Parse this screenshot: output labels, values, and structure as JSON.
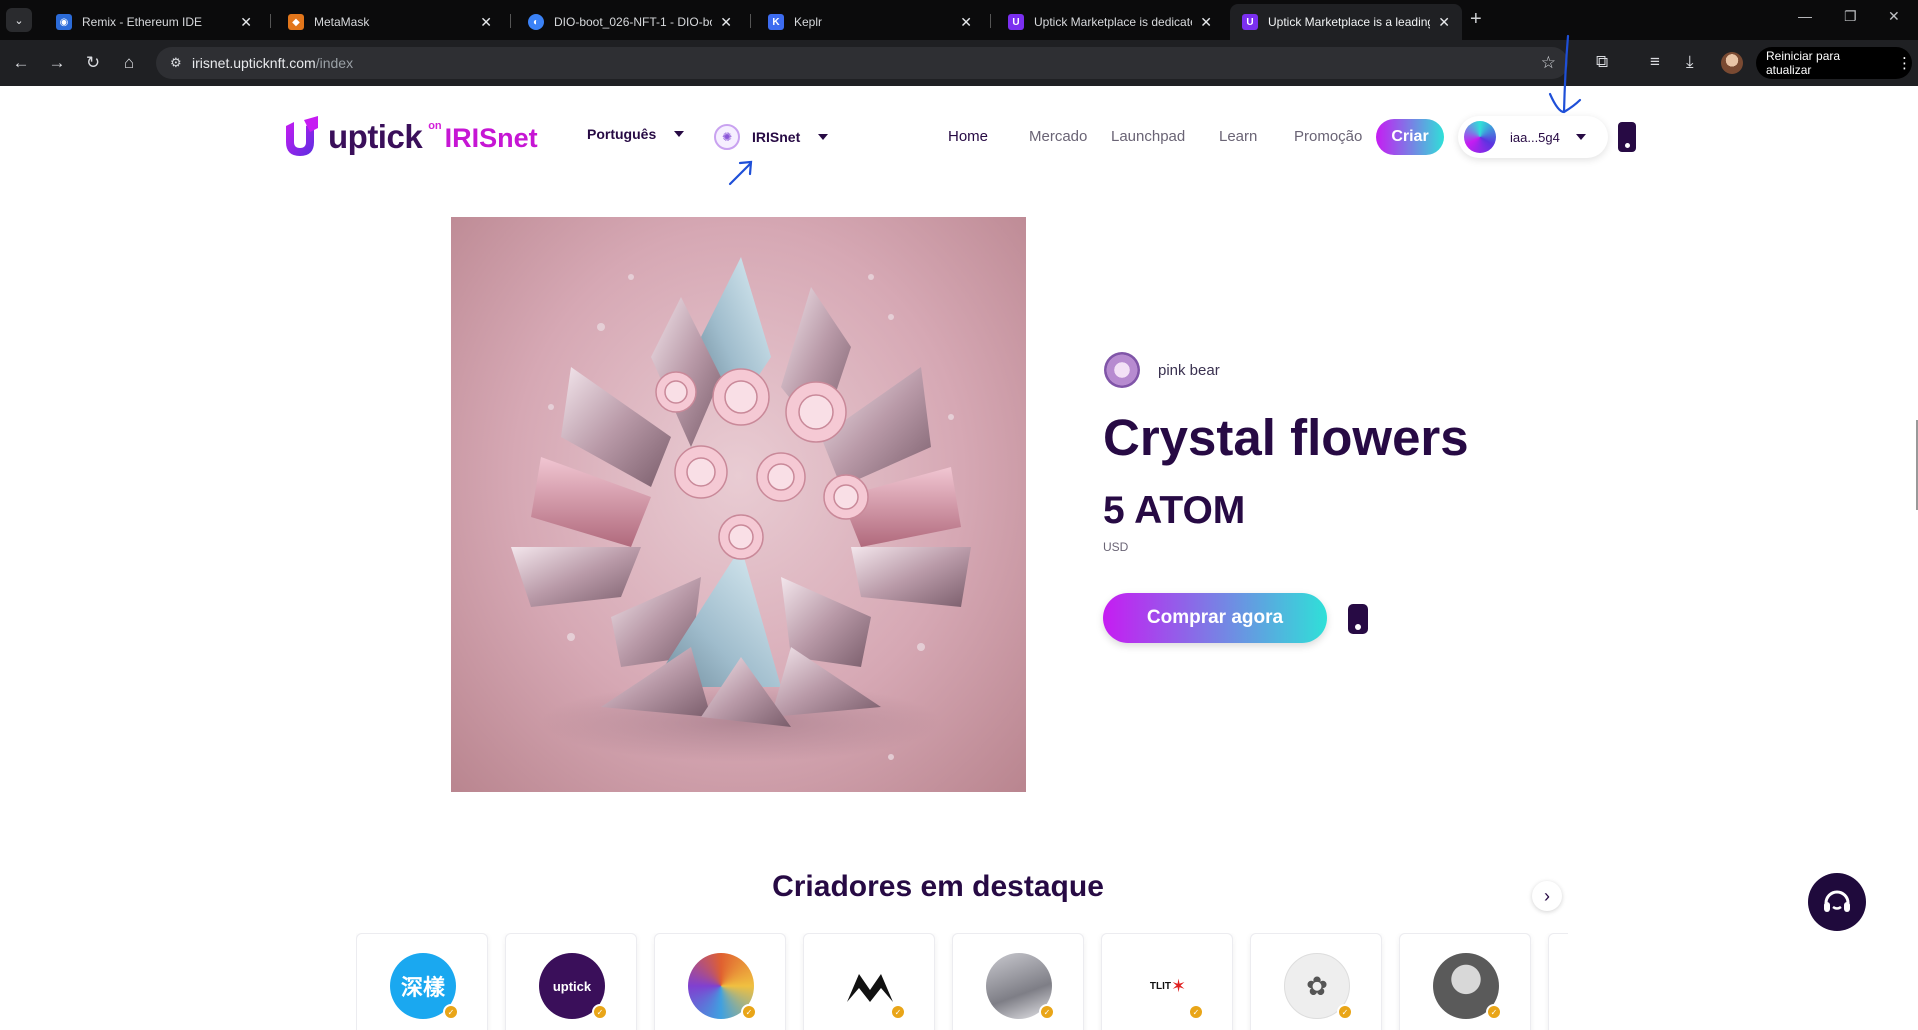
{
  "browser": {
    "tabs": [
      {
        "title": "Remix - Ethereum IDE",
        "icon": "remix-icon"
      },
      {
        "title": "MetaMask",
        "icon": "metamask-fox-icon"
      },
      {
        "title": "DIO-boot_026-NFT-1 - DIO-bo",
        "icon": "dio-icon"
      },
      {
        "title": "Keplr",
        "icon": "keplr-icon"
      },
      {
        "title": "Uptick Marketplace is dedicate",
        "icon": "uptick-icon"
      },
      {
        "title": "Uptick Marketplace is a leading",
        "icon": "uptick-icon",
        "active": true
      }
    ],
    "url_host": "irisnet.upticknft.com",
    "url_path": "/index",
    "update_button": "Reiniciar para atualizar"
  },
  "header": {
    "logo_main": "uptick",
    "logo_on": "on",
    "logo_network": "IRISnet",
    "language": "Português",
    "chain": "IRISnet",
    "nav": [
      "Home",
      "Mercado",
      "Launchpad",
      "Learn",
      "Promoção"
    ],
    "create_label": "Criar",
    "wallet_address": "iaa...5g4"
  },
  "hero": {
    "creator_name": "pink bear",
    "title": "Crystal flowers",
    "price": "5 ATOM",
    "fiat": "USD",
    "buy_label": "Comprar agora"
  },
  "featured": {
    "title": "Criadores em destaque",
    "creators": [
      {
        "avatar_text": "深樣",
        "color": "#1aa8f0",
        "icon": "creator-avatar"
      },
      {
        "avatar_text": "uptick",
        "color": "#3a0f5a",
        "icon": "uptick-avatar"
      },
      {
        "avatar_text": "",
        "color": "#e06030",
        "icon": "robot-avatar"
      },
      {
        "avatar_text": "",
        "color": "#ffffff",
        "icon": "mountain-logo-avatar"
      },
      {
        "avatar_text": "",
        "color": "#9a9aa0",
        "icon": "gallery-avatar"
      },
      {
        "avatar_text": "TLIT",
        "color": "#ffffff",
        "icon": "red-star-avatar"
      },
      {
        "avatar_text": "",
        "color": "#eeeeee",
        "icon": "sketch-flower-avatar"
      },
      {
        "avatar_text": "",
        "color": "#6a6a6a",
        "icon": "bearded-man-avatar"
      }
    ]
  },
  "colors": {
    "brand_dark": "#270a44",
    "brand_purple": "#c61cf2",
    "brand_teal": "#2fe0d8",
    "badge_gold": "#e9a518"
  }
}
